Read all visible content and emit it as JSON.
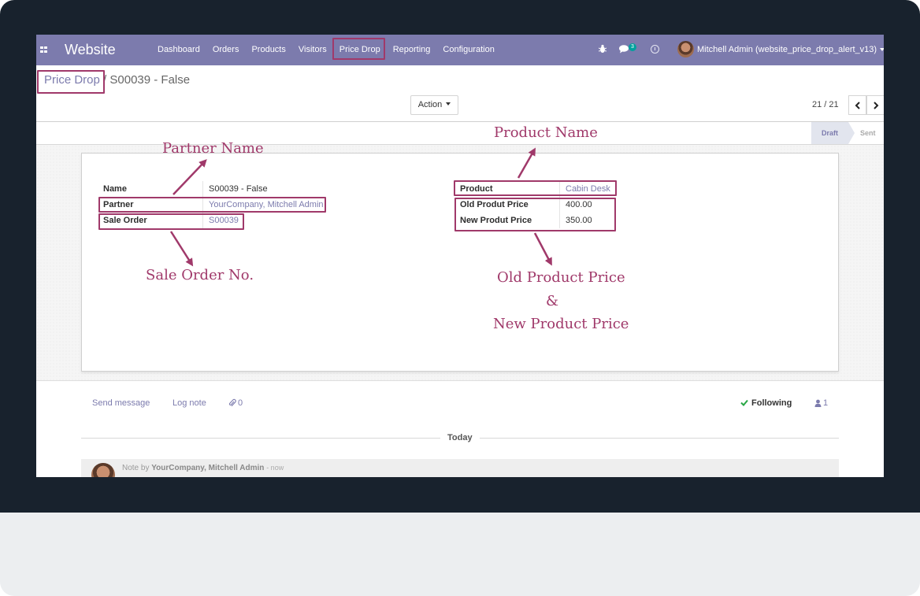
{
  "app": {
    "brand": "Website"
  },
  "nav": {
    "menu": [
      "Dashboard",
      "Orders",
      "Products",
      "Visitors",
      "Price Drop",
      "Reporting",
      "Configuration"
    ],
    "messages_count": "3",
    "user_name": "Mitchell Admin (website_price_drop_alert_v13)"
  },
  "breadcrumb": {
    "parent": "Price Drop",
    "separator": "/",
    "current": "S00039 - False"
  },
  "toolbar": {
    "action_label": "Action",
    "pager": "21 / 21"
  },
  "statusbar": {
    "stages": [
      "Draft",
      "Sent"
    ],
    "current": "Draft"
  },
  "form": {
    "left": [
      {
        "label": "Name",
        "value": "S00039 - False",
        "link": false
      },
      {
        "label": "Partner",
        "value": "YourCompany, Mitchell Admin",
        "link": true
      },
      {
        "label": "Sale Order",
        "value": "S00039",
        "link": true
      }
    ],
    "right": [
      {
        "label": "Product",
        "value": "Cabin Desk",
        "link": true
      },
      {
        "label": "Old Produt Price",
        "value": "400.00",
        "link": false
      },
      {
        "label": "New Produt Price",
        "value": "350.00",
        "link": false
      }
    ]
  },
  "annotations": {
    "partner_name": "Partner Name",
    "product_name": "Product Name",
    "sale_order_no": "Sale Order No.",
    "old_price_line1": "Old Product Price",
    "old_price_line2": "&",
    "old_price_line3": "New Product Price",
    "color": "#a0396a"
  },
  "chatter": {
    "send_message": "Send message",
    "log_note": "Log note",
    "attachments": "0",
    "following": "Following",
    "followers": "1",
    "today": "Today",
    "note_prefix": "Note by",
    "note_author": "YourCompany, Mitchell Admin",
    "note_time": "- now"
  },
  "colors": {
    "navbar": "#7c7bad",
    "bezel": "#18222d",
    "accent": "#7c7bad"
  }
}
